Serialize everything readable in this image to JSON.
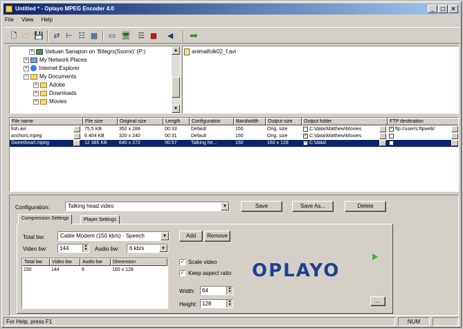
{
  "window": {
    "title": "Untitled * - Oplayo MPEG Encoder 4.0",
    "controls": {
      "minimize": "_",
      "maximize": "□",
      "close": "×"
    }
  },
  "menu": [
    "File",
    "View",
    "Help"
  ],
  "toolbar_icons": [
    "new-icon",
    "open-icon",
    "save-icon",
    "add-file-icon",
    "add-folder-icon",
    "list-view-icon",
    "details-view-icon",
    "preview-icon",
    "settings-icon",
    "encode-icon",
    "stop-icon",
    "back-icon",
    "start-icon"
  ],
  "tree": {
    "items": [
      {
        "label": "Vattuan Sanapon on 'Bitegrx(Ssonx)' (P:)",
        "icon": "network-drive-icon"
      },
      {
        "label": "My Network Places",
        "icon": "network-icon"
      },
      {
        "label": "Internet Explorer",
        "icon": "ie-icon"
      },
      {
        "label": "My Documents",
        "icon": "folder-icon"
      },
      {
        "label": "Adobe",
        "icon": "folder-icon"
      },
      {
        "label": "Downloads",
        "icon": "folder-icon"
      },
      {
        "label": "Movies",
        "icon": "folder-icon"
      }
    ]
  },
  "filelist": {
    "items": [
      "animalfolk02_f.avi"
    ]
  },
  "grid": {
    "headers": [
      "File name",
      "File size",
      "Original size",
      "Length",
      "Configuration",
      "Bandwidth",
      "Output size",
      "Output folder",
      "FTP destination"
    ],
    "rows": [
      {
        "file": "fish.avi",
        "size": "75,5 KB",
        "orig": "352 x 288",
        "length": "00:33",
        "config": "Default",
        "bandwidth": "150",
        "output_size": "Orig. size",
        "folder_checked": false,
        "folder": "C:\\data\\Matthew\\Movies",
        "ftp_checked": true,
        "ftp": "ftp://user/s:ftpweb/",
        "selected": false
      },
      {
        "file": "anchors.mpeg",
        "size": "6 404 KB",
        "orig": "320 x 240",
        "length": "00:31",
        "config": "Default",
        "bandwidth": "150",
        "output_size": "Orig. size",
        "folder_checked": true,
        "folder": "C:\\data\\Matthew\\Movies",
        "ftp_checked": false,
        "ftp": "",
        "selected": false
      },
      {
        "file": "Sweetheart.mpeg",
        "size": "12 385 KB",
        "orig": "640 x 272",
        "length": "00:57",
        "config": "Talking he...",
        "bandwidth": "150",
        "output_size": "160 x 128",
        "folder_checked": true,
        "folder": "C:\\data\\",
        "ftp_checked": false,
        "ftp": "",
        "selected": true
      }
    ]
  },
  "config_panel": {
    "configuration_label": "Configuration:",
    "configuration_value": "Talking head video",
    "save": "Save",
    "save_as": "Save As...",
    "delete": "Delete",
    "tabs": [
      "Compression Settings",
      "Player Settings"
    ],
    "total_bw_label": "Total bw:",
    "total_bw_value": "Cable Modem (150 kb/s) - Speech",
    "add": "Add",
    "remove": "Remove",
    "video_bw_label": "Video bw:",
    "video_bw_value": "144",
    "audio_bw_label": "Audio bw:",
    "audio_bw_value": "6 kb/s",
    "table": {
      "headers": [
        "Total bw",
        "Video bw",
        "Audio bw",
        "Dimension"
      ],
      "rows": [
        [
          "150",
          "144",
          "6",
          "160 x 128"
        ]
      ]
    },
    "scale_video": "Scale video",
    "keep_aspect": "Keep aspect ratio",
    "width_label": "Width:",
    "width_value": "64",
    "height_label": "Height:",
    "height_value": "128",
    "logo": "OPLAYO",
    "more_button": "..."
  },
  "status": {
    "help": "For Help, press F1",
    "num": "NUM"
  }
}
